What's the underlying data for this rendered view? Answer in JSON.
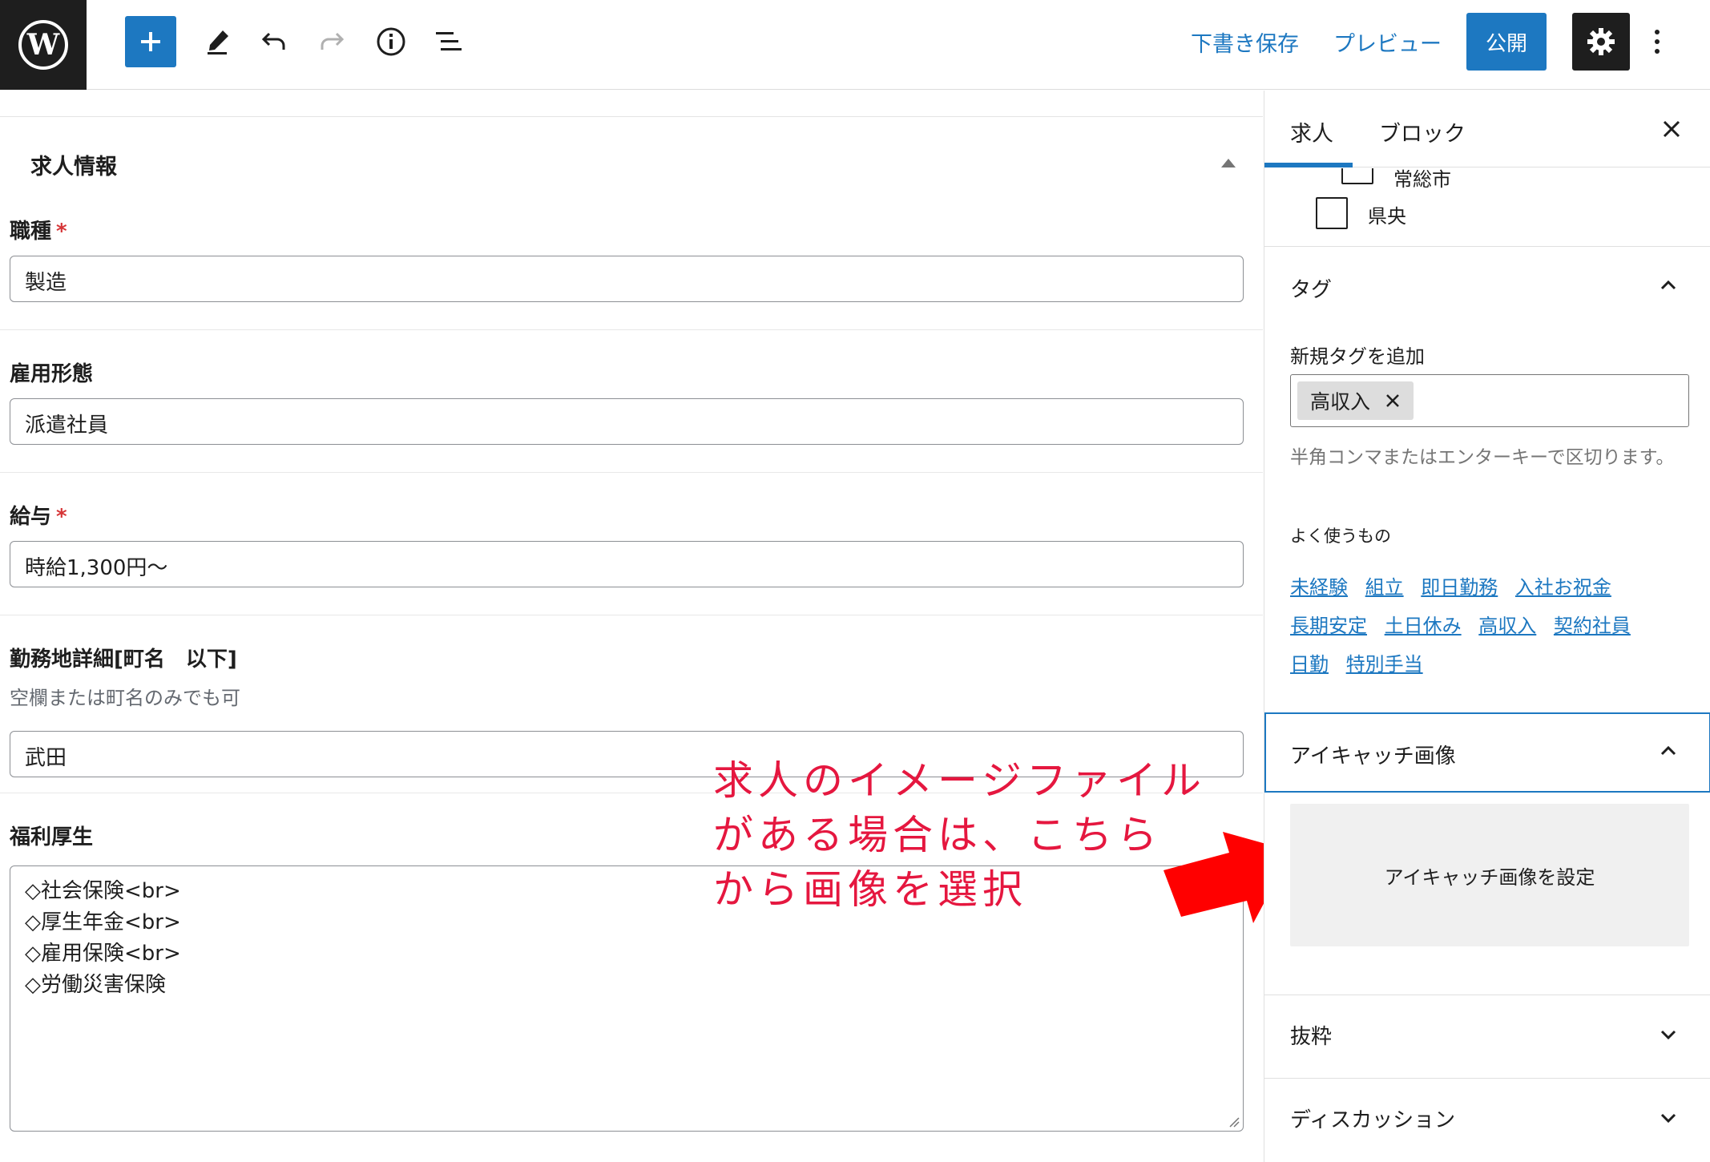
{
  "toolbar": {
    "save_draft": "下書き保存",
    "preview": "プレビュー",
    "publish": "公開"
  },
  "panel": {
    "title": "求人情報"
  },
  "fields": {
    "job_type": {
      "label": "職種",
      "value": "製造"
    },
    "employment": {
      "label": "雇用形態",
      "value": "派遣社員"
    },
    "salary": {
      "label": "給与",
      "value": "時給1,300円〜"
    },
    "location": {
      "label": "勤務地詳細[町名　以下]",
      "desc": "空欄または町名のみでも可",
      "value": "武田"
    },
    "benefits": {
      "label": "福利厚生",
      "lines": [
        "◇社会保険<br>",
        "◇厚生年金<br>",
        "◇雇用保険<br>",
        "◇労働災害保険"
      ]
    }
  },
  "required_mark": "*",
  "annotation": {
    "line1": "求人のイメージファイル",
    "line2": "がある場合は、こちら",
    "line3": "から画像を選択"
  },
  "sidebar": {
    "tabs": [
      "求人",
      "ブロック"
    ],
    "checkbox_items": [
      "常総市",
      "県央"
    ],
    "tags": {
      "title": "タグ",
      "add_label": "新規タグを追加",
      "current": "高収入",
      "help": "半角コンマまたはエンターキーで区切ります。",
      "common_label": "よく使うもの",
      "common": [
        "未経験",
        "組立",
        "即日勤務",
        "入社お祝金",
        "長期安定",
        "土日休み",
        "高収入",
        "契約社員",
        "日勤",
        "特別手当"
      ]
    },
    "featured": {
      "title": "アイキャッチ画像",
      "button": "アイキャッチ画像を設定"
    },
    "excerpt": {
      "title": "抜粋"
    },
    "discussion": {
      "title": "ディスカッション"
    }
  },
  "colors": {
    "accent": "#1d78c1",
    "annotation": "#e5173f",
    "arrow": "#ff0000",
    "required": "#d63638"
  }
}
